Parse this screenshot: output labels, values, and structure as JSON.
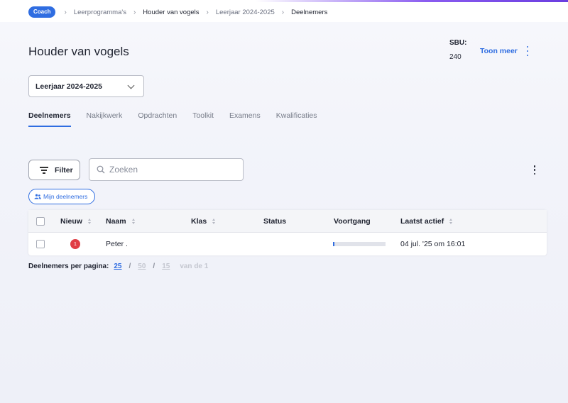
{
  "breadcrumb": {
    "badge": "Coach",
    "items": [
      "Leerprogramma's",
      "Houder van vogels",
      "Leerjaar 2024-2025",
      "Deelnemers"
    ],
    "separator": "›"
  },
  "header": {
    "title": "Houder van vogels",
    "sbu_label": "SBU:",
    "sbu_value": "240",
    "toon_meer": "Toon meer"
  },
  "year_select": {
    "value": "Leerjaar 2024-2025"
  },
  "tabs": [
    {
      "label": "Deelnemers",
      "active": true
    },
    {
      "label": "Nakijkwerk"
    },
    {
      "label": "Opdrachten"
    },
    {
      "label": "Toolkit"
    },
    {
      "label": "Examens"
    },
    {
      "label": "Kwalificaties"
    }
  ],
  "toolbar": {
    "filter_label": "Filter",
    "search_placeholder": "Zoeken",
    "mijn_deelnemers": "Mijn deelnemers"
  },
  "table": {
    "headers": {
      "nieuw": "Nieuw",
      "naam": "Naam",
      "klas": "Klas",
      "status": "Status",
      "voortgang": "Voortgang",
      "laatst_actief": "Laatst actief"
    },
    "rows": [
      {
        "nieuw": "1",
        "naam": "Peter .",
        "klas": "",
        "status": "",
        "voortgang": 0.03,
        "laatst_actief": "04 jul. '25 om 16:01"
      }
    ]
  },
  "pagination": {
    "label": "Deelnemers per pagina:",
    "options": [
      "25",
      "50",
      "15"
    ],
    "separator": "/",
    "total": "van de 1"
  },
  "colors": {
    "accent": "#2f6de1",
    "new_badge": "#e03e45"
  }
}
